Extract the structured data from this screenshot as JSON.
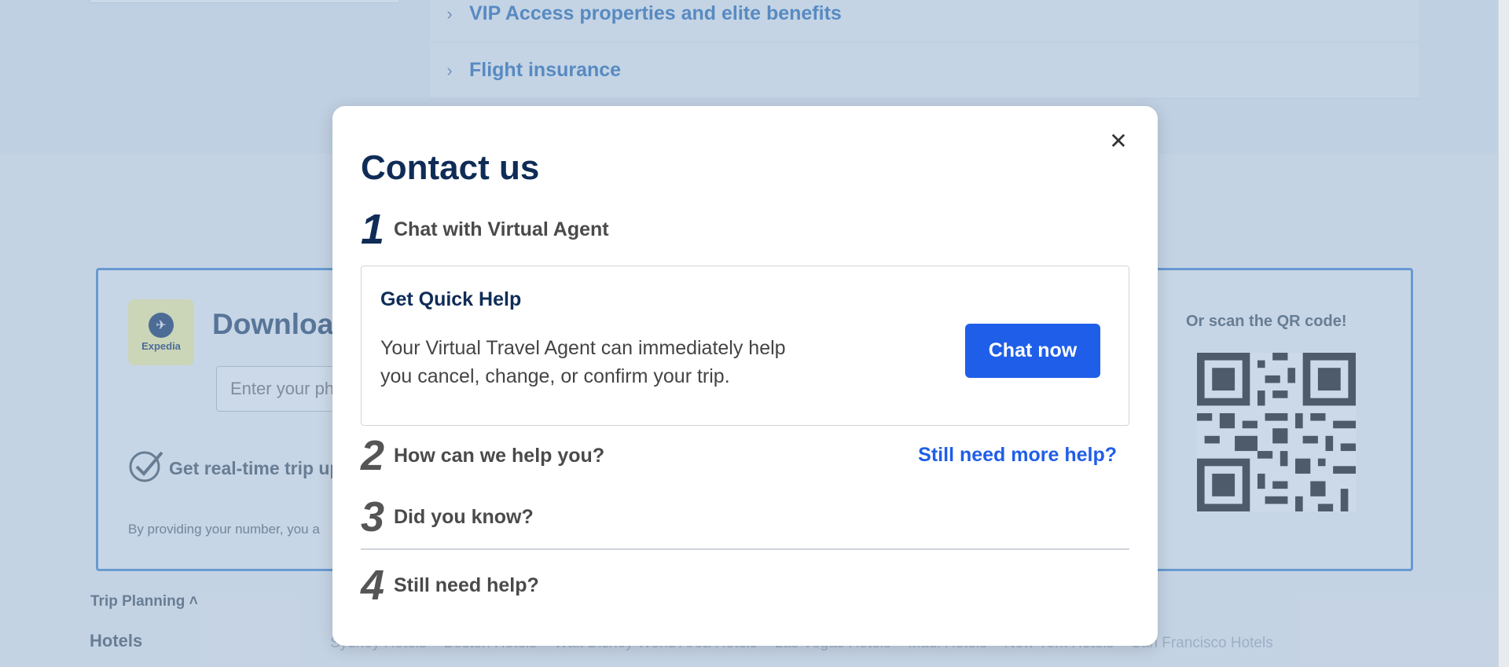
{
  "background": {
    "accordion": [
      {
        "label": "VIP Access properties and elite benefits"
      },
      {
        "label": "Flight insurance"
      }
    ],
    "promo": {
      "logo_text": "Expedia",
      "title": "Download",
      "phone_placeholder": "Enter your ph",
      "realtime_text": "Get real-time trip up",
      "disclaimer": "By providing your number, you a",
      "qr_label": "Or scan the QR code!"
    },
    "footer": {
      "heading": "Trip Planning ˄",
      "category": "Hotels",
      "links": [
        "Sydney Hotels",
        "Boston Hotels",
        "Walt Disney World Area Hotels",
        "Las Vegas Hotels",
        "Maui Hotels",
        "New York Hotels",
        "San Francisco Hotels"
      ]
    }
  },
  "modal": {
    "title": "Contact us",
    "close_icon": "✕",
    "steps": [
      {
        "num": "1",
        "label": "Chat with Virtual Agent"
      },
      {
        "num": "2",
        "label": "How can we help you?"
      },
      {
        "num": "3",
        "label": "Did you know?"
      },
      {
        "num": "4",
        "label": "Still need help?"
      }
    ],
    "quick_help": {
      "title": "Get Quick Help",
      "text": "Your Virtual Travel Agent can immediately help you cancel, change, or confirm your trip.",
      "button": "Chat now"
    },
    "more_help_link": "Still need more help?"
  },
  "colors": {
    "primary_button": "#1f5ee8",
    "title_navy": "#0f2c57",
    "overlay": "rgba(140,170,205,0.45)"
  }
}
